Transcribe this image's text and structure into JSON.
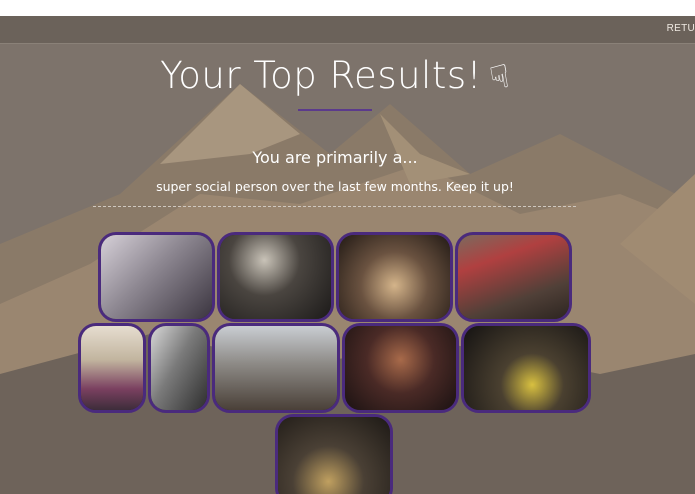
{
  "nav": {
    "return_label": "RETU"
  },
  "header": {
    "title": "Your Top Results!",
    "hand_icon": "pointing-hand-icon"
  },
  "result": {
    "intro": "You are primarily a...",
    "description": "super social person over the last few months. Keep it up!"
  },
  "colors": {
    "accent": "#4a2a7d",
    "navbar": "#6b625a",
    "background": "#7a7068"
  },
  "photos": [
    {
      "id": "photo-1",
      "tone": "#b9b4bc"
    },
    {
      "id": "photo-2",
      "tone": "#3b3a3d"
    },
    {
      "id": "photo-3",
      "tone": "#4a3f35"
    },
    {
      "id": "photo-4",
      "tone": "#6a5a4e"
    },
    {
      "id": "photo-5",
      "tone": "#cfc4b6"
    },
    {
      "id": "photo-6",
      "tone": "#7b7a7c"
    },
    {
      "id": "photo-7",
      "tone": "#8e8a86"
    },
    {
      "id": "photo-8",
      "tone": "#3a2a2a"
    },
    {
      "id": "photo-9",
      "tone": "#2a2624"
    },
    {
      "id": "photo-10",
      "tone": "#3d352c"
    }
  ]
}
